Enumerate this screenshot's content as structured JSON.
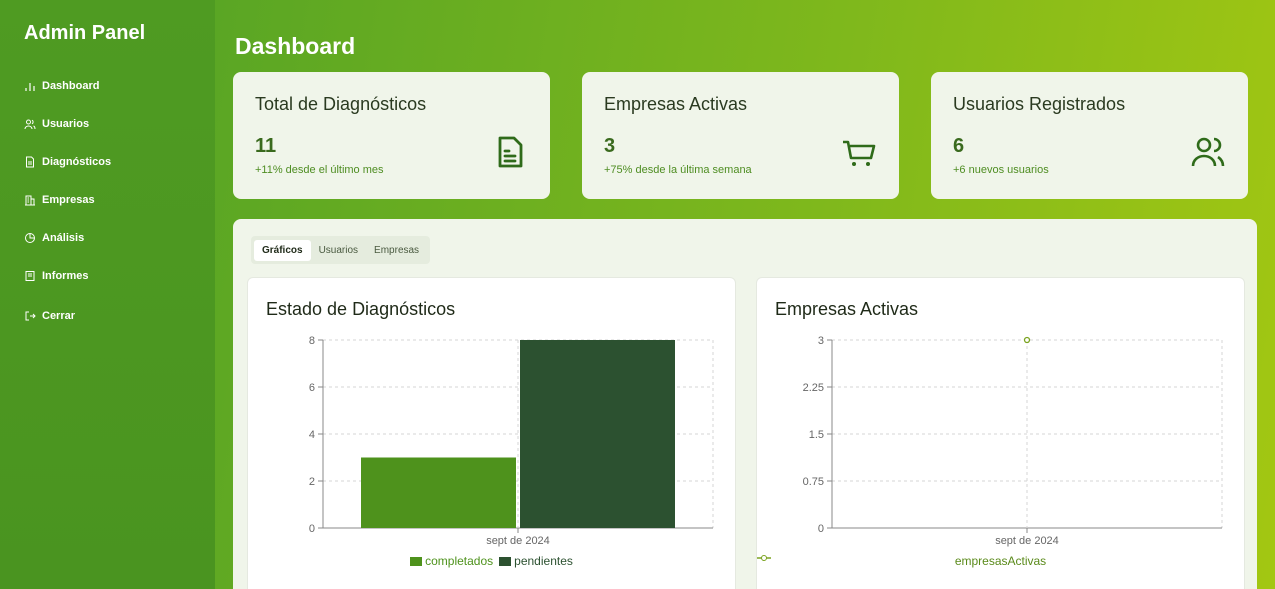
{
  "sidebar": {
    "brand": "Admin Panel",
    "items": [
      {
        "label": "Dashboard",
        "icon": "bar-chart-icon"
      },
      {
        "label": "Usuarios",
        "icon": "users-icon"
      },
      {
        "label": "Diagnósticos",
        "icon": "file-icon"
      },
      {
        "label": "Empresas",
        "icon": "building-icon"
      },
      {
        "label": "Análisis",
        "icon": "pie-chart-icon"
      },
      {
        "label": "Informes",
        "icon": "report-icon"
      },
      {
        "label": "Cerrar",
        "icon": "logout-icon"
      }
    ]
  },
  "header": {
    "title": "Dashboard"
  },
  "cards": [
    {
      "title": "Total de Diagnósticos",
      "value": "11",
      "sub": "+11% desde el último mes",
      "icon": "document-icon"
    },
    {
      "title": "Empresas Activas",
      "value": "3",
      "sub": "+75% desde la última semana",
      "icon": "cart-icon"
    },
    {
      "title": "Usuarios Registrados",
      "value": "6",
      "sub": "+6 nuevos usuarios",
      "icon": "users-icon"
    }
  ],
  "tabs": [
    {
      "label": "Gráficos",
      "active": true
    },
    {
      "label": "Usuarios",
      "active": false
    },
    {
      "label": "Empresas",
      "active": false
    }
  ],
  "colors": {
    "completados": "#4e921c",
    "pendientes": "#2c5130",
    "line": "#7aa31f",
    "sidebar": "#4f9b22"
  },
  "chart_data": [
    {
      "type": "bar",
      "title": "Estado de Diagnósticos",
      "categories": [
        "sept de 2024"
      ],
      "series": [
        {
          "name": "completados",
          "values": [
            3
          ]
        },
        {
          "name": "pendientes",
          "values": [
            8
          ]
        }
      ],
      "ylim": [
        0,
        8
      ],
      "yticks": [
        "0",
        "2",
        "4",
        "6",
        "8"
      ],
      "grid": true,
      "legend": "bottom"
    },
    {
      "type": "line",
      "title": "Empresas Activas",
      "categories": [
        "sept de 2024"
      ],
      "series": [
        {
          "name": "empresasActivas",
          "values": [
            3
          ]
        }
      ],
      "ylim": [
        0,
        3
      ],
      "yticks": [
        "0",
        "0.75",
        "1.5",
        "2.25",
        "3"
      ],
      "grid": true,
      "legend": "bottom"
    }
  ]
}
